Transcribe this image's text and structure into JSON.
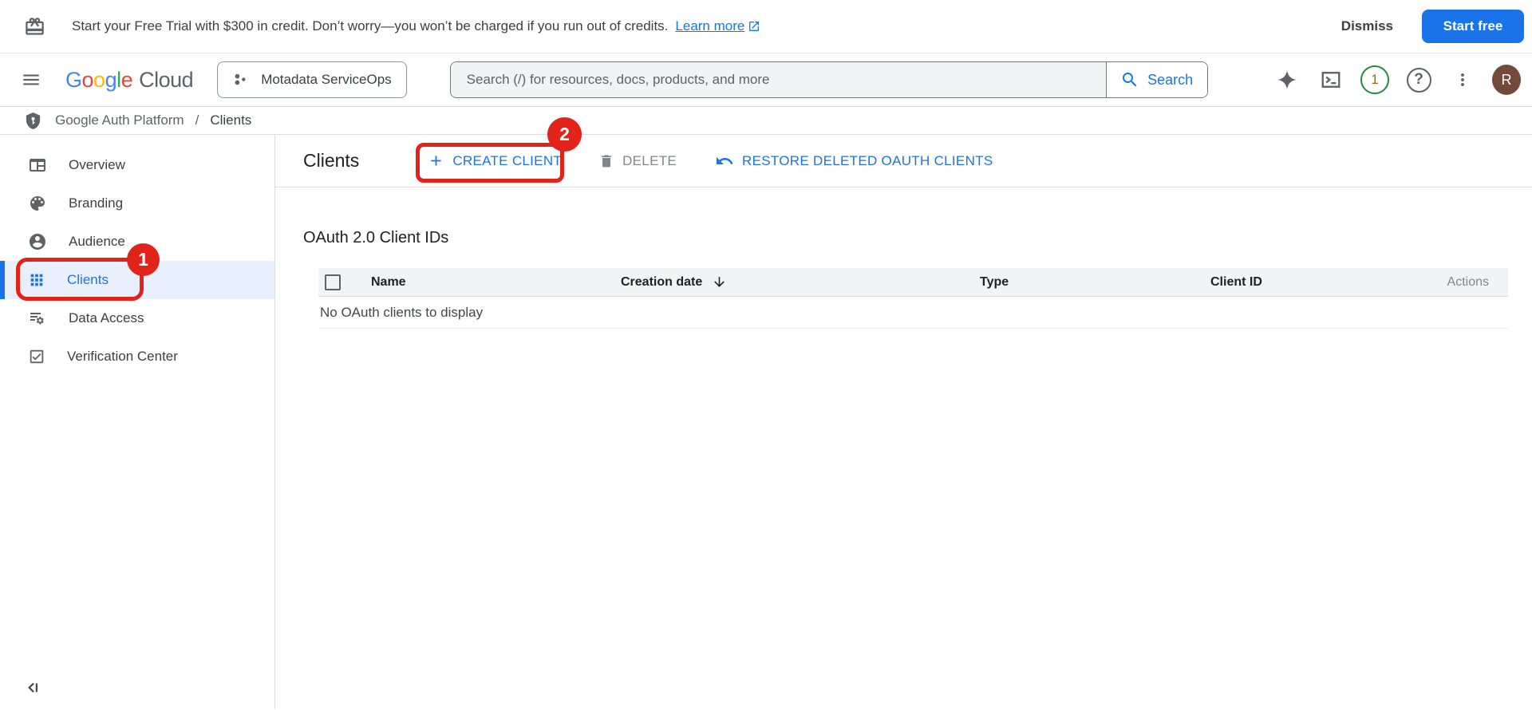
{
  "banner": {
    "message": "Start your Free Trial with $300 in credit. Don’t worry—you won’t be charged if you run out of credits.",
    "learn_more": "Learn more",
    "dismiss": "Dismiss",
    "start_free": "Start free"
  },
  "header": {
    "logo": {
      "letters": [
        "G",
        "o",
        "o",
        "g",
        "l",
        "e"
      ],
      "cloud": "Cloud"
    },
    "project_name": "Motadata ServiceOps",
    "search_placeholder": "Search (/) for resources, docs, products, and more",
    "search_button": "Search",
    "notification_count": "1",
    "help_glyph": "?",
    "avatar_initial": "R"
  },
  "breadcrumb": {
    "root": "Google Auth Platform",
    "separator": "/",
    "current": "Clients"
  },
  "sidebar": {
    "items": [
      {
        "label": "Overview",
        "selected": false
      },
      {
        "label": "Branding",
        "selected": false
      },
      {
        "label": "Audience",
        "selected": false
      },
      {
        "label": "Clients",
        "selected": true
      },
      {
        "label": "Data Access",
        "selected": false
      },
      {
        "label": "Verification Center",
        "selected": false
      }
    ]
  },
  "main": {
    "title": "Clients",
    "toolbar": {
      "create": "CREATE CLIENT",
      "delete": "DELETE",
      "restore": "RESTORE DELETED OAUTH CLIENTS"
    },
    "section_title": "OAuth 2.0 Client IDs",
    "table": {
      "columns": [
        "Name",
        "Creation date",
        "Type",
        "Client ID",
        "Actions"
      ],
      "sorted_column": "Creation date",
      "sort_direction": "desc",
      "empty_message": "No OAuth clients to display"
    }
  },
  "annotations": {
    "step1": "1",
    "step2": "2"
  },
  "colors": {
    "accent_blue": "#1a73e8",
    "annotation_red": "#e2231a",
    "selected_item_bg": "#e8f0fe",
    "notification_green": "#1e8e3e",
    "notification_count": "#b06000",
    "avatar_bg": "#73493c",
    "table_header_bg": "#f1f3f4",
    "start_free_bg": "#1a73e8"
  }
}
